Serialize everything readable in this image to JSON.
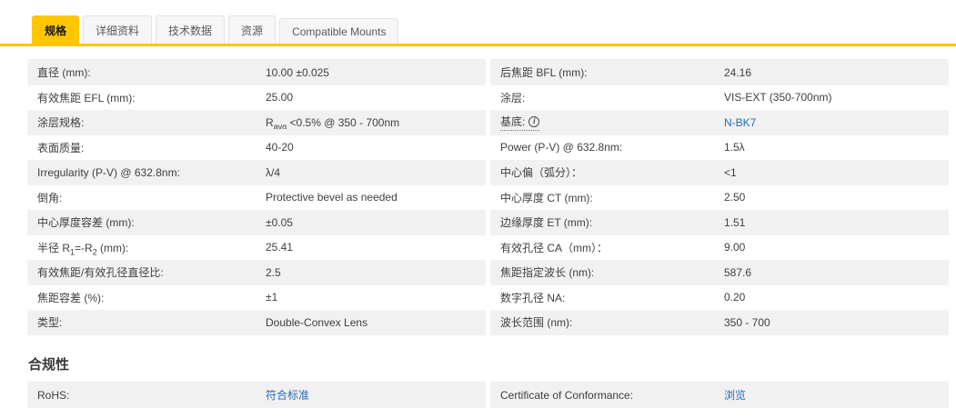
{
  "tabs": {
    "items": [
      {
        "label": "规格",
        "active": true
      },
      {
        "label": "详细资料",
        "active": false
      },
      {
        "label": "技术数据",
        "active": false
      },
      {
        "label": "资源",
        "active": false
      },
      {
        "label": "Compatible Mounts",
        "active": false
      }
    ]
  },
  "colors": {
    "accent_yellow": "#ffc600",
    "link_blue": "#2a6cb8",
    "row_alt_gray": "#f1f1f1"
  },
  "spec": {
    "left": [
      {
        "label": "直径 (mm):",
        "value": "10.00 ±0.025"
      },
      {
        "label": "有效焦距 EFL (mm):",
        "value": "25.00"
      },
      {
        "label": "涂层规格:",
        "value": "R<sub>avg</sub> <0.5% @ 350 - 700nm"
      },
      {
        "label": "表面质量:",
        "value": "40-20"
      },
      {
        "label": "Irregularity (P-V) @ 632.8nm:",
        "value": "λ/4"
      },
      {
        "label": "倒角:",
        "value": "Protective bevel as needed"
      },
      {
        "label": "中心厚度容差 (mm):",
        "value": "±0.05"
      },
      {
        "label": "半径 R<sub>1</sub>=-R<sub>2</sub> (mm):",
        "value": "25.41"
      },
      {
        "label": "有效焦距/有效孔径直径比:",
        "value": "2.5"
      },
      {
        "label": "焦距容差 (%):",
        "value": "±1"
      },
      {
        "label": "类型:",
        "value": "Double-Convex Lens"
      }
    ],
    "right": [
      {
        "label": "后焦距 BFL (mm):",
        "value": "24.16"
      },
      {
        "label": "涂层:",
        "value": "VIS-EXT (350-700nm)"
      },
      {
        "label": "基底:",
        "icon": "info-icon",
        "value": "N-BK7",
        "link": true
      },
      {
        "label": "Power (P-V) @ 632.8nm:",
        "value": "1.5λ"
      },
      {
        "label": "中心偏（弧分）：",
        "value": "<1"
      },
      {
        "label": "中心厚度 CT (mm):",
        "value": "2.50"
      },
      {
        "label": "边缘厚度 ET (mm):",
        "value": "1.51"
      },
      {
        "label": "有效孔径 CA（mm）：",
        "value": "9.00"
      },
      {
        "label": "焦距指定波长 (nm):",
        "value": "587.6"
      },
      {
        "label": "数字孔径 NA:",
        "value": "0.20"
      },
      {
        "label": "波长范围 (nm):",
        "value": "350 - 700"
      }
    ]
  },
  "compliance": {
    "heading": "合规性",
    "left": {
      "label": "RoHS:",
      "value": "符合标准",
      "link": true
    },
    "right": {
      "label": "Certificate of Conformance:",
      "value": "浏览",
      "link": true
    }
  }
}
